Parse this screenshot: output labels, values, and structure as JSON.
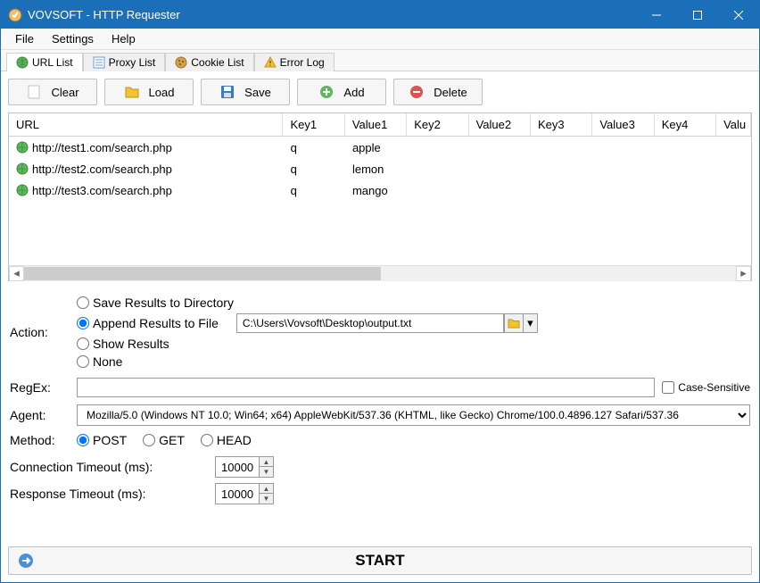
{
  "title": "VOVSOFT - HTTP Requester",
  "menu": [
    "File",
    "Settings",
    "Help"
  ],
  "tabs": [
    {
      "label": "URL List",
      "icon": "globe",
      "active": true
    },
    {
      "label": "Proxy List",
      "icon": "list",
      "active": false
    },
    {
      "label": "Cookie List",
      "icon": "cookie",
      "active": false
    },
    {
      "label": "Error Log",
      "icon": "warning",
      "active": false
    }
  ],
  "toolbar": {
    "clear": "Clear",
    "load": "Load",
    "save": "Save",
    "add": "Add",
    "delete": "Delete"
  },
  "table": {
    "cols": [
      "URL",
      "Key1",
      "Value1",
      "Key2",
      "Value2",
      "Key3",
      "Value3",
      "Key4",
      "Valu"
    ],
    "widths": [
      322,
      72,
      72,
      72,
      72,
      72,
      72,
      72,
      40
    ],
    "rows": [
      {
        "url": "http://test1.com/search.php",
        "k1": "q",
        "v1": "apple"
      },
      {
        "url": "http://test2.com/search.php",
        "k1": "q",
        "v1": "lemon"
      },
      {
        "url": "http://test3.com/search.php",
        "k1": "q",
        "v1": "mango"
      }
    ]
  },
  "action": {
    "label": "Action:",
    "options": [
      "Save Results to Directory",
      "Append Results to File",
      "Show Results",
      "None"
    ],
    "selected": 1,
    "path": "C:\\Users\\Vovsoft\\Desktop\\output.txt"
  },
  "regex": {
    "label": "RegEx:",
    "value": "",
    "cs": "Case-Sensitive"
  },
  "agent": {
    "label": "Agent:",
    "value": "Mozilla/5.0 (Windows NT 10.0; Win64; x64) AppleWebKit/537.36 (KHTML, like Gecko) Chrome/100.0.4896.127 Safari/537.36"
  },
  "method": {
    "label": "Method:",
    "options": [
      "POST",
      "GET",
      "HEAD"
    ],
    "selected": 0
  },
  "conn": {
    "label": "Connection Timeout (ms):",
    "value": "10000"
  },
  "resp": {
    "label": "Response Timeout (ms):",
    "value": "10000"
  },
  "start": "START"
}
